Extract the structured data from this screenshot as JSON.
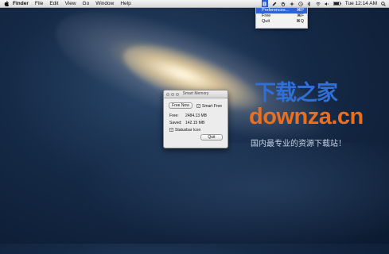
{
  "menubar": {
    "apple_icon": "apple-icon",
    "items": [
      "Finder",
      "File",
      "Edit",
      "View",
      "Go",
      "Window",
      "Help"
    ],
    "status_icons": [
      "smart-memory-icon",
      "pen-icon",
      "hand-icon",
      "sparkle-icon",
      "time-machine-icon",
      "bluetooth-icon",
      "wifi-icon",
      "volume-icon",
      "battery-icon"
    ],
    "clock": "Tue 12:14 AM",
    "search_icon": "search-icon"
  },
  "status_menu": {
    "items": [
      {
        "label": "Preferences...",
        "shortcut": "⌘P"
      },
      {
        "label": "Free",
        "shortcut": "⌘F"
      },
      {
        "label": "Quit",
        "shortcut": "⌘Q"
      }
    ]
  },
  "window": {
    "title": "Smart Memory",
    "free_now_label": "Free Now",
    "smart_free_label": "Smart Free",
    "smart_free_checked": true,
    "free_label": "Free:",
    "free_value": "2484.13 MB",
    "saved_label": "Saved:",
    "saved_value": "142.15 MB",
    "statusbar_icon_label": "Statusbar Icon",
    "statusbar_icon_checked": true,
    "quit_label": "Quit"
  },
  "watermark": {
    "chinese": "下载之家",
    "domain": "downza.cn",
    "tagline": "国内最专业的资源下载站！"
  },
  "colors": {
    "menu_highlight": "#2e63d4",
    "watermark_blue": "#2f6fd6",
    "watermark_orange": "#ea6f1e"
  }
}
